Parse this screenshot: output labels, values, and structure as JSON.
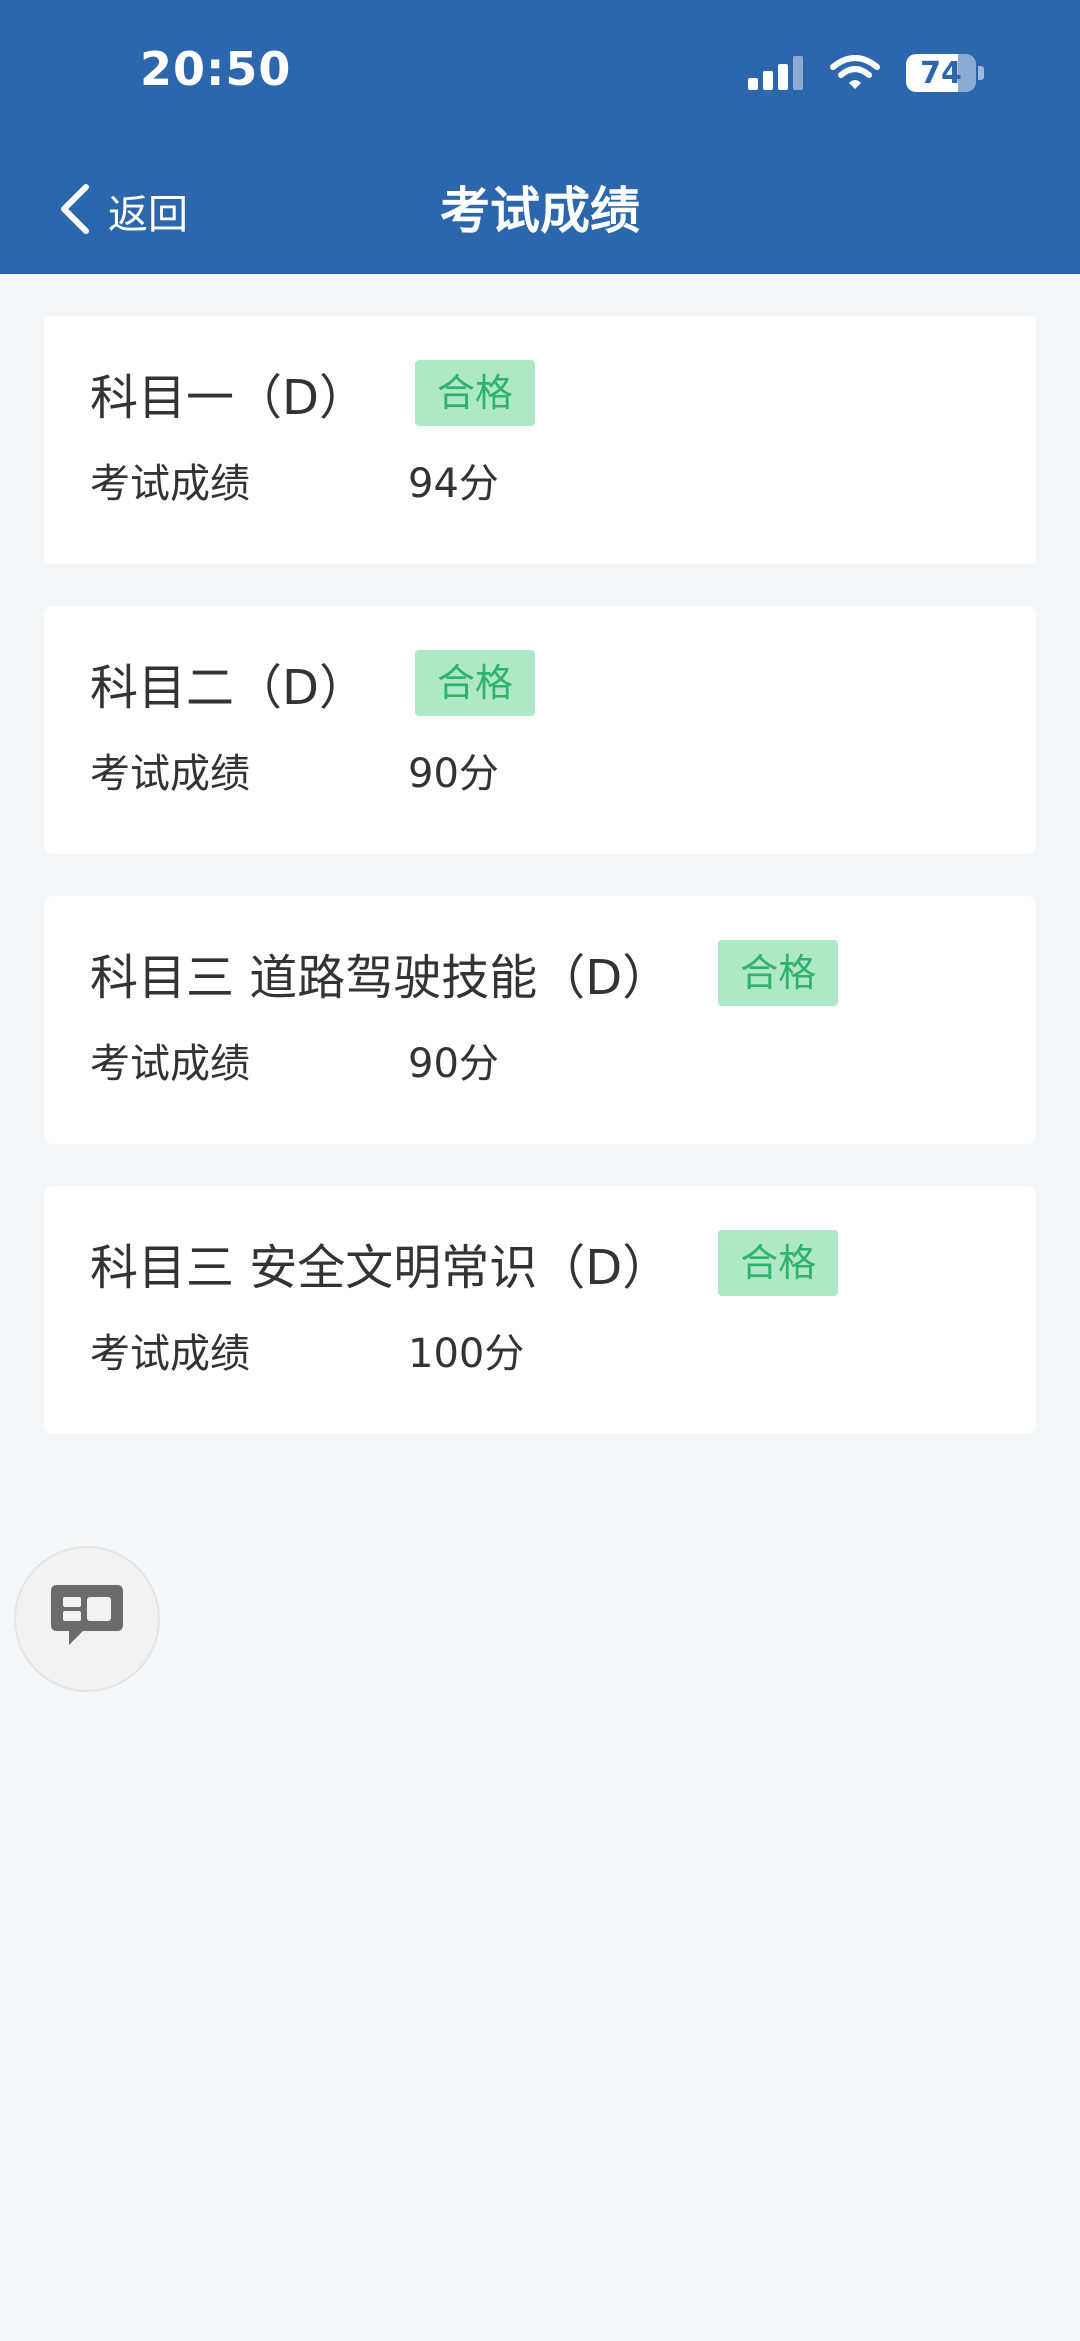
{
  "status_bar": {
    "time": "20:50",
    "battery": "74",
    "battery_level": 0.74
  },
  "nav": {
    "back_label": "返回",
    "title": "考试成绩"
  },
  "cards": [
    {
      "title": "科目一（D）",
      "badge": "合格",
      "score_label": "考试成绩",
      "score": "94分"
    },
    {
      "title": "科目二（D）",
      "badge": "合格",
      "score_label": "考试成绩",
      "score": "90分"
    },
    {
      "title": "科目三 道路驾驶技能（D）",
      "badge": "合格",
      "score_label": "考试成绩",
      "score": "90分"
    },
    {
      "title": "科目三 安全文明常识（D）",
      "badge": "合格",
      "score_label": "考试成绩",
      "score": "100分"
    }
  ],
  "colors": {
    "header_bg": "#2c66ad",
    "badge_bg": "#aee8c6",
    "badge_text": "#2fb36a",
    "page_bg": "#f4f7f9"
  },
  "icons": {
    "back": "chevron-left-icon",
    "signal": "signal-icon",
    "wifi": "wifi-icon",
    "battery": "battery-icon",
    "chat": "chat-bubble-icon"
  }
}
